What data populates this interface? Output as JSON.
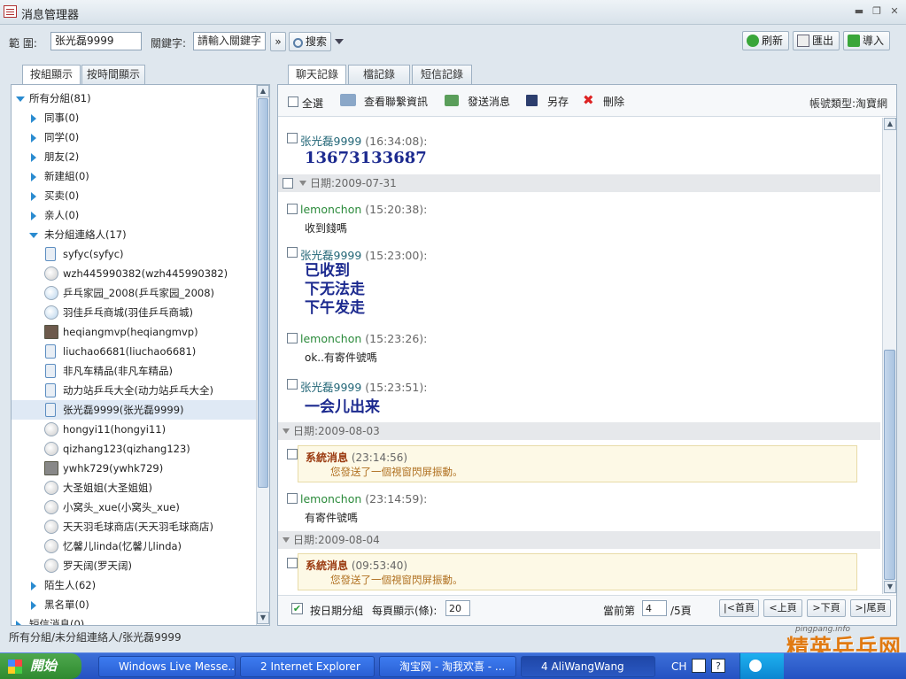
{
  "window": {
    "title": "消息管理器"
  },
  "toolbar": {
    "scope_label": "範 圍:",
    "scope_value": "张光磊9999",
    "keyword_label": "關鍵字:",
    "keyword_placeholder": "請輸入關鍵字",
    "search_label": "搜索",
    "refresh_label": "刷新",
    "export_label": "匯出",
    "import_label": "導入"
  },
  "left_tabs": [
    "按組顯示",
    "按時間顯示"
  ],
  "tree": [
    {
      "label": "所有分組(81)"
    },
    {
      "label": "同事(0)"
    },
    {
      "label": "同学(0)"
    },
    {
      "label": "朋友(2)"
    },
    {
      "label": "新建組(0)"
    },
    {
      "label": "买卖(0)"
    },
    {
      "label": "亲人(0)"
    },
    {
      "label": "未分組連絡人(17)"
    },
    {
      "label": "syfyc(syfyc)"
    },
    {
      "label": "wzh445990382(wzh445990382)"
    },
    {
      "label": "乒乓家园_2008(乒乓家园_2008)"
    },
    {
      "label": "羽佳乒乓商城(羽佳乒乓商城)"
    },
    {
      "label": "heqiangmvp(heqiangmvp)"
    },
    {
      "label": "liuchao6681(liuchao6681)"
    },
    {
      "label": "非凡车精品(非凡车精品)"
    },
    {
      "label": "动力站乒乓大全(动力站乒乓大全)"
    },
    {
      "label": "张光磊9999(张光磊9999)"
    },
    {
      "label": "hongyi11(hongyi11)"
    },
    {
      "label": "qizhang123(qizhang123)"
    },
    {
      "label": "ywhk729(ywhk729)"
    },
    {
      "label": "大圣姐姐(大圣姐姐)"
    },
    {
      "label": "小窝头_xue(小窝头_xue)"
    },
    {
      "label": "天天羽毛球商店(天天羽毛球商店)"
    },
    {
      "label": "忆馨儿linda(忆馨儿linda)"
    },
    {
      "label": "罗天阔(罗天阔)"
    },
    {
      "label": "陌生人(62)"
    },
    {
      "label": "黑名單(0)"
    },
    {
      "label": "短信消息(0)"
    }
  ],
  "right_tabs": [
    "聊天記錄",
    "檔記錄",
    "短信記錄"
  ],
  "actions": {
    "select_all": "全選",
    "view_contact": "查看聯繫資訊",
    "send_message": "發送消息",
    "save_as": "另存",
    "delete": "刪除",
    "account_type": "帳號類型:淘寶網"
  },
  "messages": {
    "m1": {
      "name": "张光磊9999",
      "time": "(16:34:08):",
      "text": "13673133687"
    },
    "d1": "日期:2009-07-31",
    "m2": {
      "name": "lemonchon",
      "time": "(15:20:38):",
      "text": "收到錢嗎"
    },
    "m3": {
      "name": "张光磊9999",
      "time": "(15:23:00):",
      "line1": "已收到",
      "line2": "下无法走",
      "line3": "下午发走"
    },
    "m4": {
      "name": "lemonchon",
      "time": "(15:23:26):",
      "text": "ok..有寄件號嗎"
    },
    "m5": {
      "name": "张光磊9999",
      "time": "(15:23:51):",
      "text": "一会儿出来"
    },
    "d2": "日期:2009-08-03",
    "s1": {
      "name": "系統消息",
      "time": "(23:14:56)",
      "text": "您發送了一個視窗閃屏振動。"
    },
    "m6": {
      "name": "lemonchon",
      "time": "(23:14:59):",
      "text": "有寄件號嗎"
    },
    "d3": "日期:2009-08-04",
    "s2": {
      "name": "系統消息",
      "time": "(09:53:40)",
      "text": "您發送了一個視窗閃屏振動。"
    }
  },
  "footer": {
    "group_by_date": "按日期分組",
    "per_page_label": "每頁顯示(條):",
    "per_page": "20",
    "current_label": "當前第",
    "current_page": "4",
    "total": "/5頁",
    "first": "|<首頁",
    "prev": "<上頁",
    "next": ">下頁",
    "last": ">|尾頁"
  },
  "status_path": "所有分組/未分組連絡人/张光磊9999",
  "taskbar": {
    "start": "開始",
    "tasks": [
      "Windows Live Messe...",
      "2 Internet Explorer",
      "淘宝网 - 淘我欢喜 - ...",
      "4 AliWangWang"
    ],
    "lang": "CH"
  },
  "watermark": {
    "site": "pingpang.info",
    "brand": "精英乒乓网"
  }
}
